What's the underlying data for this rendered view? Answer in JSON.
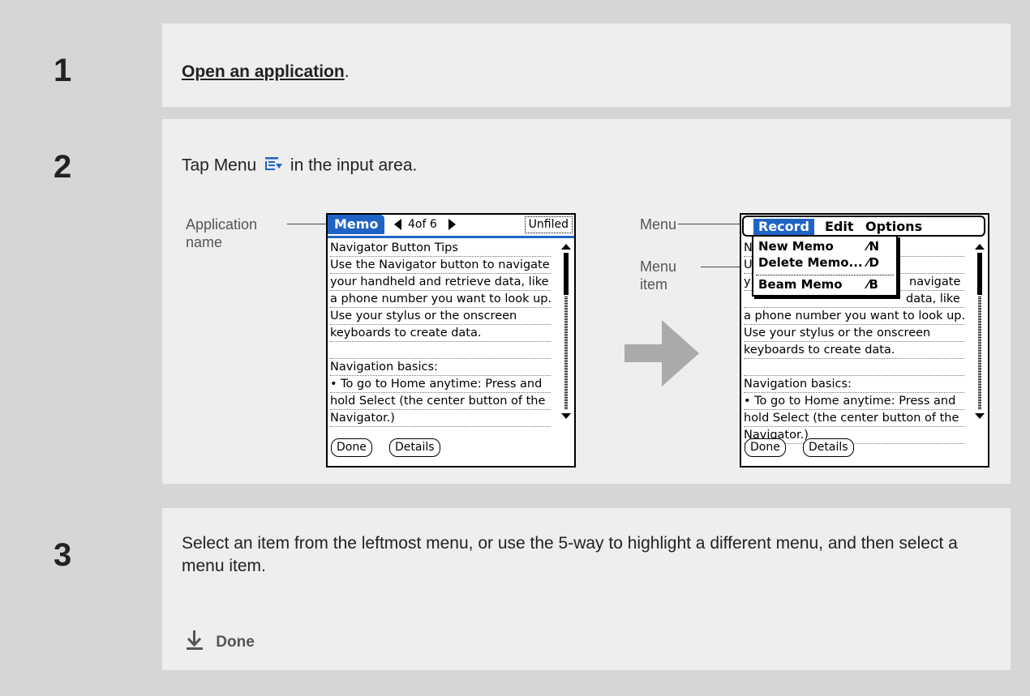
{
  "steps": [
    {
      "number": "1",
      "link": "Open an application",
      "suffix": "."
    },
    {
      "number": "2",
      "text": "Tap Menu",
      "text_after": "in the input area."
    },
    {
      "number": "3",
      "text": "Select an item from the leftmost menu, or use the 5-way to highlight a different menu, and then select a menu item."
    }
  ],
  "callouts": {
    "app_name": [
      "Application",
      "name"
    ],
    "menu": "Menu",
    "menu_item": [
      "Menu",
      "item"
    ]
  },
  "palm": {
    "app": "Memo",
    "pager": "4of 6",
    "category": "Unfiled",
    "lines": [
      "Navigator Button Tips",
      "Use the Navigator button to navigate",
      "your handheld and retrieve data, like",
      "a phone number you want to look up.",
      "Use your stylus or the onscreen",
      "keyboards to create data.",
      "",
      "Navigation basics:",
      "• To go to Home anytime: Press and",
      "hold Select (the center button of the",
      "Navigator.)"
    ],
    "buttons": {
      "done": "Done",
      "details": "Details"
    },
    "menubar": {
      "record": "Record",
      "edit": "Edit",
      "options": "Options"
    },
    "menu_items": [
      {
        "label": "New Memo",
        "shortcut": "⁄N"
      },
      {
        "label": "Delete Memo...",
        "shortcut": "⁄D"
      },
      {
        "label": "Beam Memo",
        "shortcut": "⁄B"
      }
    ],
    "partial_lines": [
      {
        "left": "N",
        "right": ""
      },
      {
        "left": "U",
        "right": ""
      },
      {
        "left": "y",
        "right": "navigate"
      },
      {
        "left": "",
        "right": "data, like"
      }
    ]
  },
  "done_label": "Done",
  "icons": [
    "menu-icon",
    "right-arrow-icon",
    "down-arrow-icon",
    "scroll-up-icon",
    "scroll-down-icon"
  ],
  "colors": {
    "accent": "#1f63c6",
    "panel": "#eeeeee",
    "background": "#d6d6d6"
  }
}
